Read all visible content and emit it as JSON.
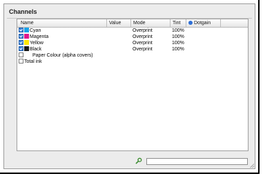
{
  "panel": {
    "title": "Channels"
  },
  "table": {
    "columns": {
      "name": "Name",
      "value": "Value",
      "mode": "Mode",
      "tint": "Tint",
      "spot": "Dotgain"
    },
    "rows": [
      {
        "name": "Cyan",
        "mode": "Overprint",
        "tint": "100%",
        "checked": true,
        "swatch": "#1aa3e8"
      },
      {
        "name": "Magenta",
        "mode": "Overprint",
        "tint": "100%",
        "checked": true,
        "swatch": "#e0188c"
      },
      {
        "name": "Yellow",
        "mode": "Overprint",
        "tint": "100%",
        "checked": true,
        "swatch": "#ffe600"
      },
      {
        "name": "Black",
        "mode": "Overprint",
        "tint": "100%",
        "checked": true,
        "swatch": "#1a1a1a"
      },
      {
        "name": "Paper Colour (alpha covers)",
        "mode": "",
        "tint": "",
        "checked": false,
        "swatch": ""
      },
      {
        "name": "Total ink",
        "mode": "",
        "tint": "",
        "checked": false,
        "swatch": ""
      }
    ]
  },
  "search": {
    "value": "",
    "icon": "magnifier-icon"
  },
  "colors": {
    "panel_bg": "#ececec",
    "spot_dot": "#2f6fd6",
    "checkbox_on": "#3d83d8"
  }
}
